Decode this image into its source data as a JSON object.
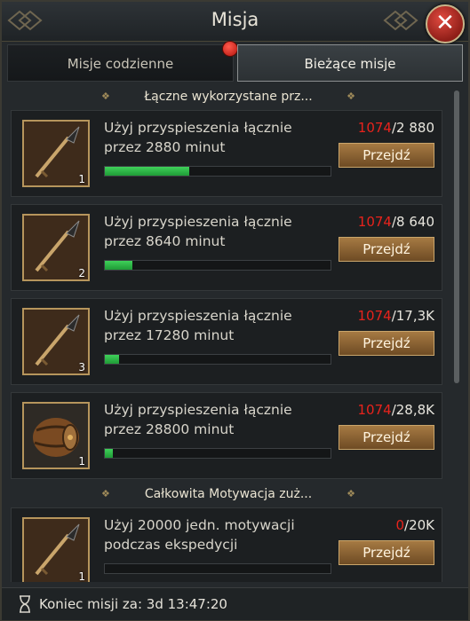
{
  "window": {
    "title": "Misja"
  },
  "tabs": [
    {
      "label": "Misje codzienne",
      "active": false,
      "has_notification": true
    },
    {
      "label": "Bieżące misje",
      "active": true
    }
  ],
  "sections": [
    {
      "label": "Łączne wykorzystane prz..."
    },
    {
      "label": "Całkowita Motywacja zuż..."
    }
  ],
  "missions": [
    {
      "desc": "Użyj przyspieszenia łącznie przez 2880 minut",
      "current": "1074",
      "target": "2 880",
      "progress": 0.373,
      "qty": "1",
      "icon": "spear-icon",
      "button": "Przejdź"
    },
    {
      "desc": "Użyj przyspieszenia łącznie przez 8640 minut",
      "current": "1074",
      "target": "8 640",
      "progress": 0.124,
      "qty": "2",
      "icon": "spear-icon",
      "button": "Przejdź"
    },
    {
      "desc": "Użyj przyspieszenia łącznie przez 17280 minut",
      "current": "1074",
      "target": "17,3K",
      "progress": 0.062,
      "qty": "3",
      "icon": "spear-icon",
      "button": "Przejdź"
    },
    {
      "desc": "Użyj przyspieszenia łącznie przez 28800 minut",
      "current": "1074",
      "target": "28,8K",
      "progress": 0.037,
      "qty": "1",
      "icon": "barrel-icon",
      "button": "Przejdź"
    },
    {
      "desc": "Użyj 20000 jedn. motywacji podczas ekspedycji",
      "current": "0",
      "target": "20K",
      "progress": 0.0,
      "qty": "1",
      "icon": "spear-icon",
      "button": "Przejdź"
    }
  ],
  "footer": {
    "label": "Koniec misji za: 3d 13:47:20"
  },
  "colors": {
    "accent_red": "#e8231c",
    "progress_green": "#2fbf4a",
    "button_bronze": "#8c6433"
  }
}
